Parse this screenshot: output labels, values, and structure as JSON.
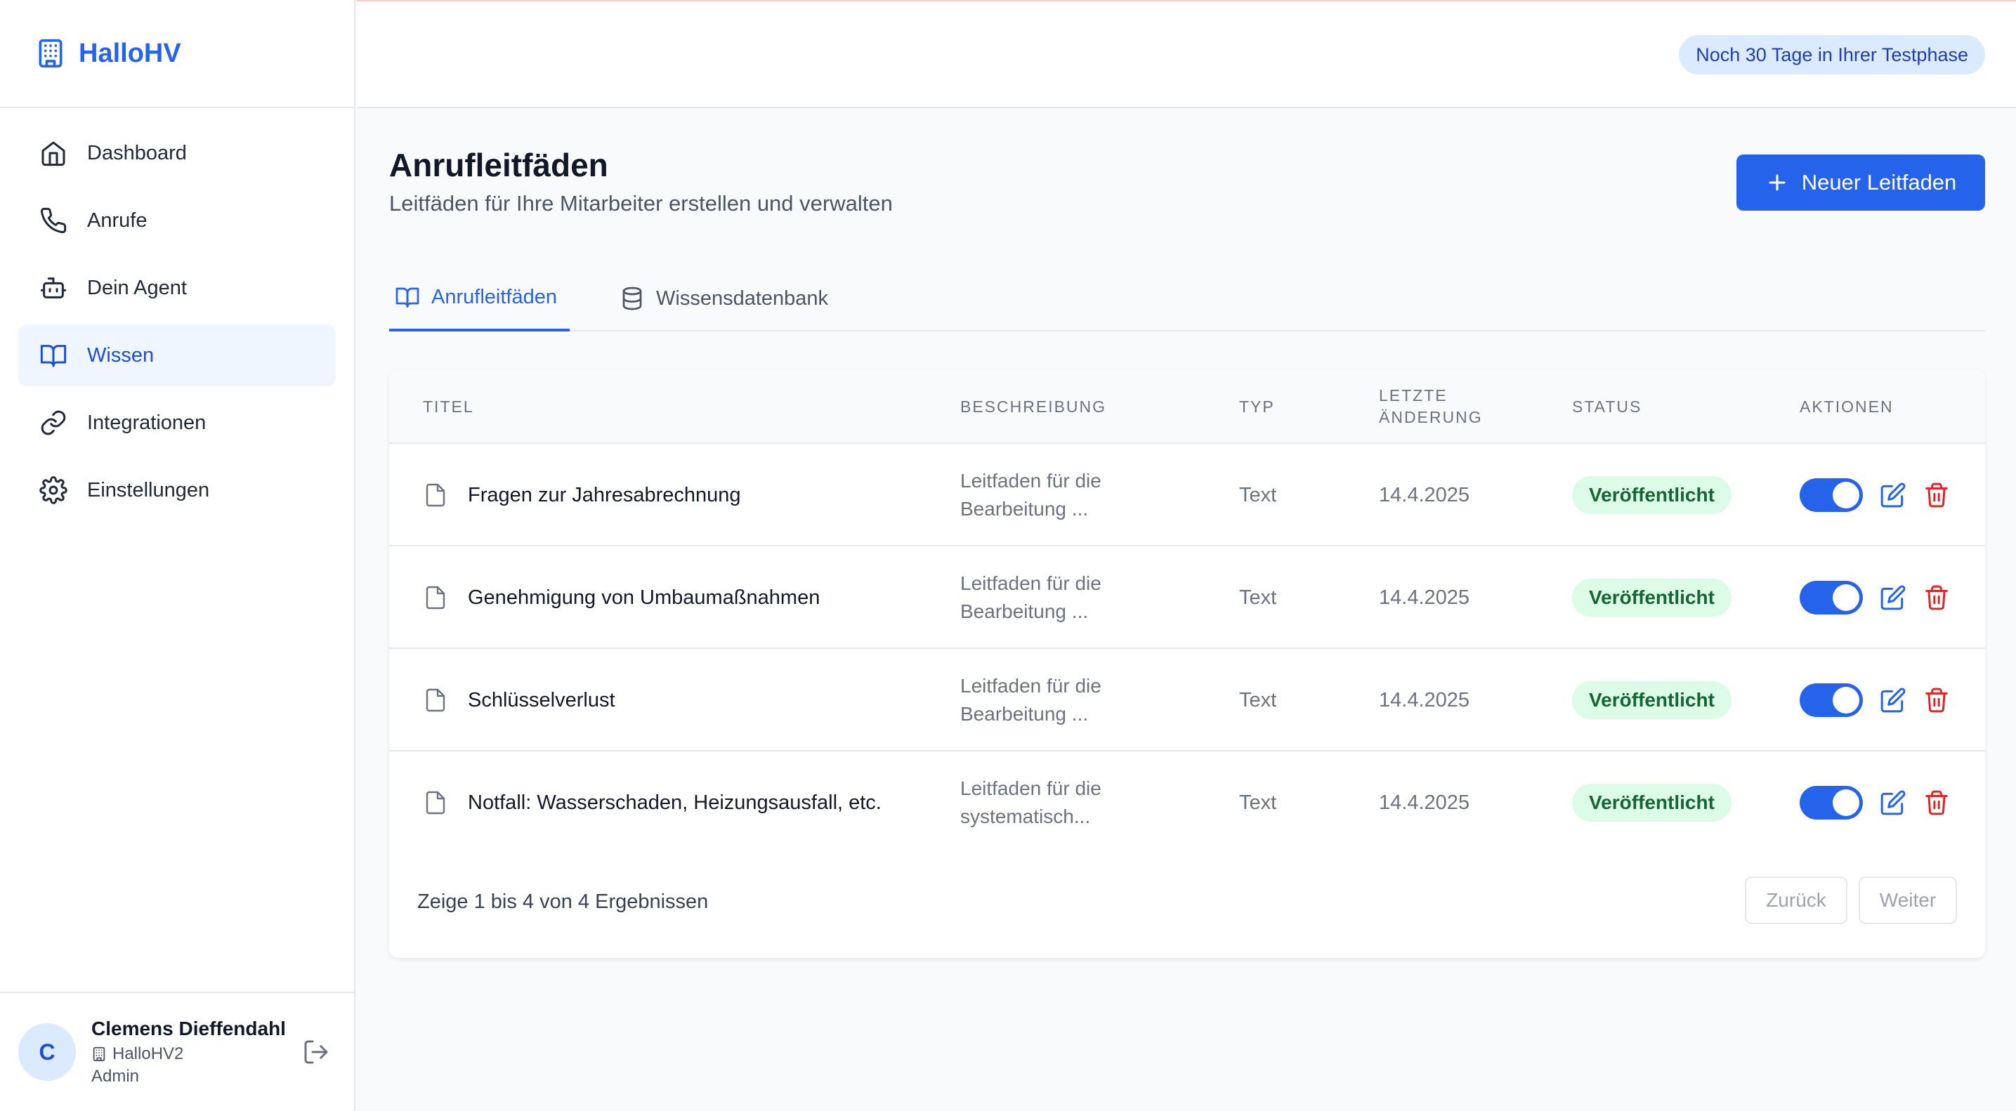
{
  "app": {
    "name": "HalloHV"
  },
  "sidebar": {
    "items": [
      {
        "label": "Dashboard",
        "icon": "home-icon"
      },
      {
        "label": "Anrufe",
        "icon": "phone-icon"
      },
      {
        "label": "Dein Agent",
        "icon": "bot-icon"
      },
      {
        "label": "Wissen",
        "icon": "book-icon",
        "active": true
      },
      {
        "label": "Integrationen",
        "icon": "link-icon"
      },
      {
        "label": "Einstellungen",
        "icon": "gear-icon"
      }
    ]
  },
  "user": {
    "initial": "C",
    "name": "Clemens Dieffendahl",
    "org": "HalloHV2",
    "role": "Admin"
  },
  "header": {
    "trial_badge": "Noch 30 Tage in Ihrer Testphase"
  },
  "page": {
    "title": "Anrufleitfäden",
    "subtitle": "Leitfäden für Ihre Mitarbeiter erstellen und verwalten",
    "new_button": "Neuer Leitfaden"
  },
  "tabs": [
    {
      "label": "Anrufleitfäden",
      "active": true
    },
    {
      "label": "Wissensdatenbank",
      "active": false
    }
  ],
  "table": {
    "columns": {
      "title": "Titel",
      "description": "Beschreibung",
      "type": "Typ",
      "changed": "Letzte Änderung",
      "status": "Status",
      "actions": "Aktionen"
    },
    "rows": [
      {
        "title": "Fragen zur Jahresabrechnung",
        "desc_line1": "Leitfaden für die",
        "desc_line2": "Bearbeitung ...",
        "type": "Text",
        "date": "14.4.2025",
        "status": "Veröffentlicht",
        "enabled": true
      },
      {
        "title": "Genehmigung von Umbaumaßnahmen",
        "desc_line1": "Leitfaden für die",
        "desc_line2": "Bearbeitung ...",
        "type": "Text",
        "date": "14.4.2025",
        "status": "Veröffentlicht",
        "enabled": true
      },
      {
        "title": "Schlüsselverlust",
        "desc_line1": "Leitfaden für die",
        "desc_line2": "Bearbeitung ...",
        "type": "Text",
        "date": "14.4.2025",
        "status": "Veröffentlicht",
        "enabled": true
      },
      {
        "title": "Notfall: Wasserschaden, Heizungsausfall, etc.",
        "desc_line1": "Leitfaden für die",
        "desc_line2": "systematisch...",
        "type": "Text",
        "date": "14.4.2025",
        "status": "Veröffentlicht",
        "enabled": true
      }
    ]
  },
  "pagination": {
    "summary": "Zeige 1 bis 4 von 4 Ergebnissen",
    "prev": "Zurück",
    "next": "Weiter"
  },
  "colors": {
    "accent": "#2563eb",
    "status_bg": "#dcfce7",
    "status_text": "#166534",
    "danger": "#dc2626"
  }
}
